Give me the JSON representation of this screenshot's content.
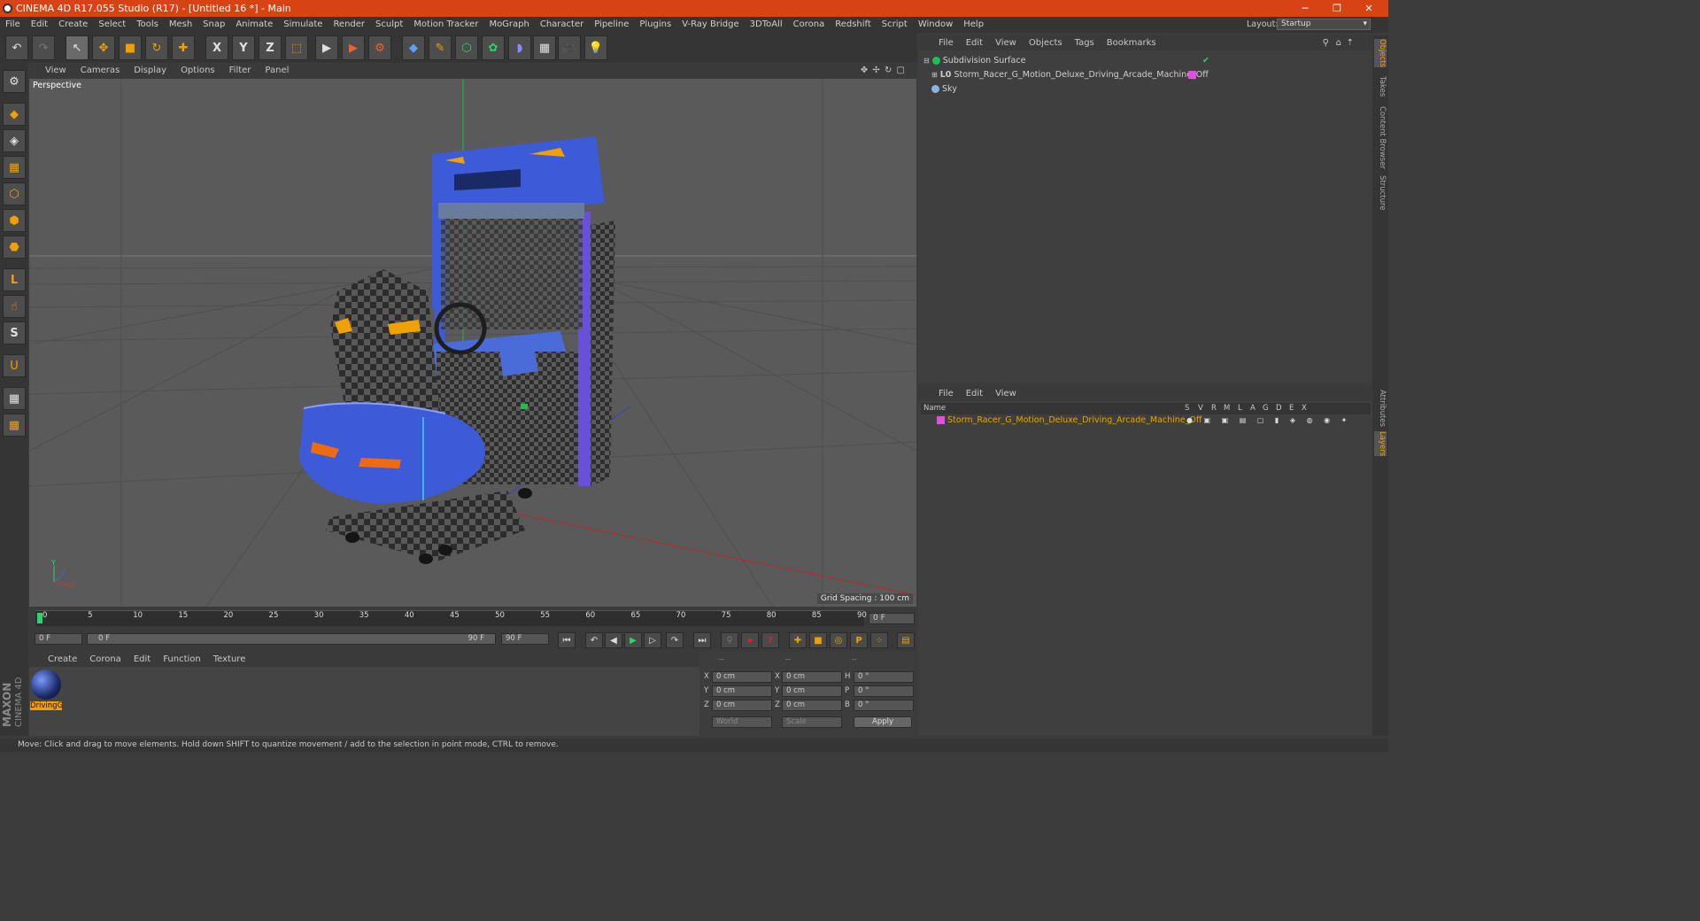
{
  "window": {
    "title": "CINEMA 4D R17.055 Studio (R17) - [Untitled 16 *] - Main",
    "minimize": "─",
    "restore": "❐",
    "close": "✕"
  },
  "menu": [
    "File",
    "Edit",
    "Create",
    "Select",
    "Tools",
    "Mesh",
    "Snap",
    "Animate",
    "Simulate",
    "Render",
    "Sculpt",
    "Motion Tracker",
    "MoGraph",
    "Character",
    "Pipeline",
    "Plugins",
    "V-Ray Bridge",
    "3DToAll",
    "Corona",
    "Redshift",
    "Script",
    "Window",
    "Help"
  ],
  "layout": {
    "label": "Layout:",
    "value": "Startup"
  },
  "toolbar_icons": {
    "undo": "↶",
    "redo": "↷",
    "select": "↖",
    "move": "✥",
    "scale": "■",
    "rotate": "↻",
    "move2": "✚",
    "x": "X",
    "y": "Y",
    "z": "Z",
    "coord": "⬚",
    "render_view": "▶",
    "render_pic": "▶",
    "render_settings": "⚙",
    "cube": "◆",
    "pen": "✎",
    "subdiv": "⬡",
    "array": "✿",
    "deformer": "◗",
    "floor": "▦",
    "camera": "🎥",
    "light": "💡"
  },
  "left_tools": {
    "mode": "⚙",
    "model": "◆",
    "texture": "◈",
    "workplane": "▦",
    "points": "⬡",
    "edges": "⬢",
    "polys": "⬣",
    "axis": "L",
    "tweak": "☝",
    "snap": "S",
    "magnet": "U",
    "lock_wp": "▦",
    "grid": "▦"
  },
  "viewport": {
    "menu": [
      "View",
      "Cameras",
      "Display",
      "Options",
      "Filter",
      "Panel"
    ],
    "name": "Perspective",
    "grid_spacing": "Grid Spacing : 100 cm",
    "nav_icons": "✥ ✢ ↻ ▢",
    "axis_y": "Y",
    "axis_x": "X",
    "axis_z": "Z"
  },
  "timeline": {
    "ticks": [
      "0",
      "5",
      "10",
      "15",
      "20",
      "25",
      "30",
      "35",
      "40",
      "45",
      "50",
      "55",
      "60",
      "65",
      "70",
      "75",
      "80",
      "85",
      "90"
    ],
    "current_frame": "0 F",
    "start": "0 F",
    "range_start": "0 F",
    "range_end": "90 F",
    "end": "90 F"
  },
  "playback_icons": {
    "first": "⏮",
    "prev_key": "↶",
    "prev": "◀",
    "play": "▶",
    "next": "▷",
    "next_key": "↷",
    "last": "⏭",
    "key_sel": "⚲",
    "record": "⏺",
    "auto": "?",
    "move": "✚",
    "scale": "■",
    "rotate": "◎",
    "param": "P",
    "pla": "⁘",
    "timeline": "▤"
  },
  "material": {
    "menu": [
      "Create",
      "Corona",
      "Edit",
      "Function",
      "Texture"
    ],
    "items": [
      {
        "name": "DrivingG"
      }
    ],
    "brand": "MAXON",
    "product": "CINEMA 4D"
  },
  "coords": {
    "headers": [
      "--",
      "--",
      "--"
    ],
    "rows": [
      {
        "a": "X",
        "av": "0 cm",
        "b": "X",
        "bv": "0 cm",
        "c": "H",
        "cv": "0 °"
      },
      {
        "a": "Y",
        "av": "0 cm",
        "b": "Y",
        "bv": "0 cm",
        "c": "P",
        "cv": "0 °"
      },
      {
        "a": "Z",
        "av": "0 cm",
        "b": "Z",
        "bv": "0 cm",
        "c": "B",
        "cv": "0 °"
      }
    ],
    "space": "World",
    "mode": "Scale",
    "apply": "Apply"
  },
  "object_manager": {
    "menu": [
      "File",
      "Edit",
      "View",
      "Objects",
      "Tags",
      "Bookmarks"
    ],
    "objects": [
      {
        "name": "Subdivision Surface",
        "color": "#1dbf5a"
      },
      {
        "name": "Storm_Racer_G_Motion_Deluxe_Driving_Arcade_Machine_Off",
        "color": "#e050e0"
      },
      {
        "name": "Sky",
        "color": "#8ab4e8"
      }
    ]
  },
  "layer_manager": {
    "menu": [
      "File",
      "Edit",
      "View"
    ],
    "columns": [
      "Name",
      "S",
      "V",
      "R",
      "M",
      "L",
      "A",
      "G",
      "D",
      "E",
      "X"
    ],
    "layers": [
      {
        "name": "Storm_Racer_G_Motion_Deluxe_Driving_Arcade_Machine_Off",
        "color": "#e050e0"
      }
    ]
  },
  "right_tabs": [
    "Objects",
    "Takes",
    "Content Browser",
    "Structure",
    "Attributes",
    "Layers"
  ],
  "status": "Move: Click and drag to move elements. Hold down SHIFT to quantize movement / add to the selection in point mode, CTRL to remove.",
  "colors": {
    "accent": "#d84315",
    "highlight": "#f0a000",
    "viewport_bg": "#5a5a5a",
    "machine_blue": "#3d5bd6"
  }
}
